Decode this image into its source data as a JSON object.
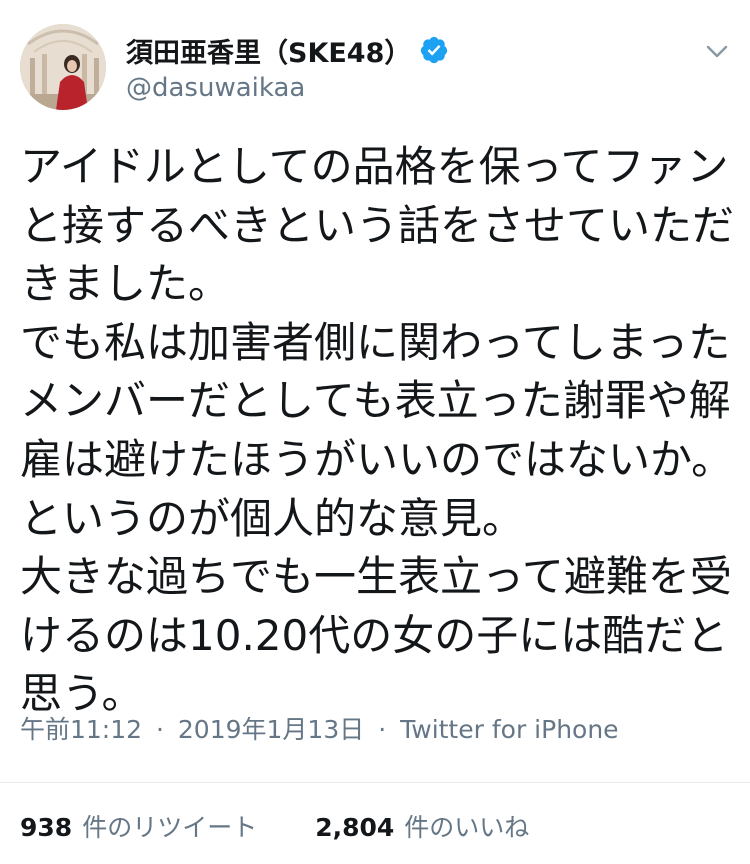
{
  "user": {
    "display_name": "須田亜香里（SKE48）",
    "handle": "@dasuwaikaa",
    "verified": true,
    "avatar_icon": "profile-photo"
  },
  "header": {
    "menu_icon": "chevron-down-icon"
  },
  "tweet": {
    "lines": [
      "アイドルとしての品格を保ってファン",
      "と接するべきという話をさせていただ",
      "きました。",
      "でも私は加害者側に関わってしまった",
      "メンバーだとしても表立った謝罪や解",
      "雇は避けたほうがいいのではないか。",
      "というのが個人的な意見。",
      "大きな過ちでも一生表立って避難を受",
      "けるのは10.20代の女の子には酷だと",
      "思う。"
    ]
  },
  "meta": {
    "time": "午前11:12",
    "separator": "·",
    "date": "2019年1月13日",
    "source": "Twitter for iPhone"
  },
  "stats": {
    "retweets_count": "938",
    "retweets_label": "件のリツイート",
    "likes_count": "2,804",
    "likes_label": "件のいいね"
  },
  "colors": {
    "text_primary": "#14171a",
    "text_secondary": "#657786",
    "verified_blue": "#1da1f2",
    "divider": "#e6ecf0"
  }
}
